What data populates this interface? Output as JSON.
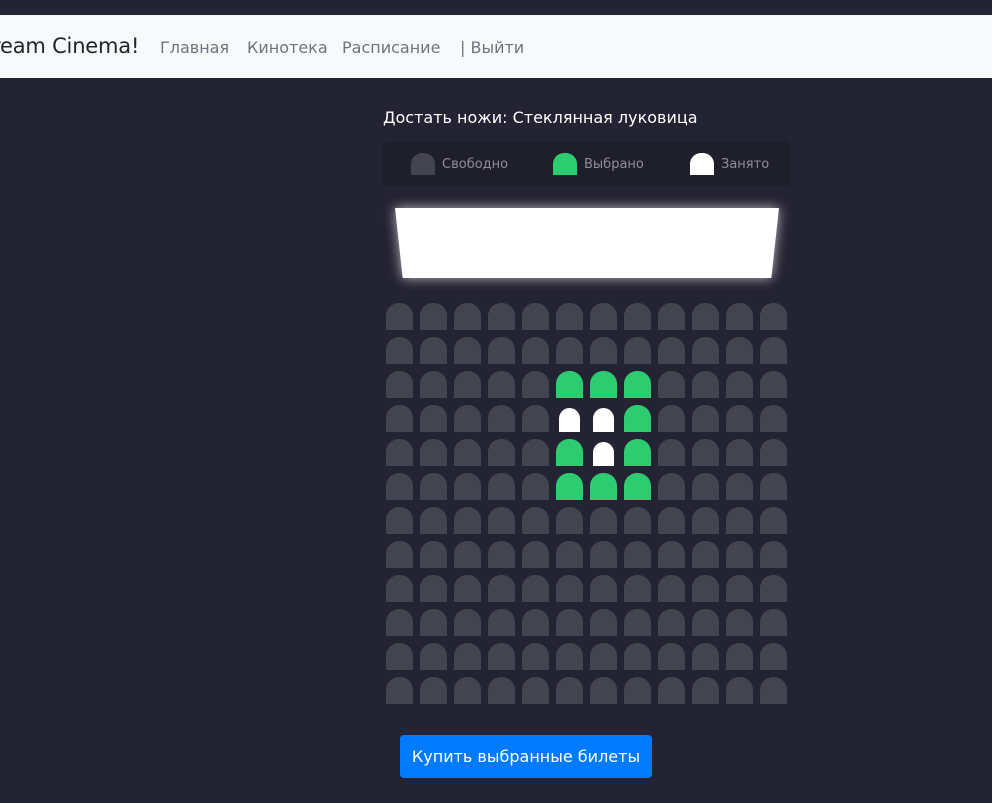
{
  "navbar": {
    "brand": "ream Cinema!",
    "links": [
      "Главная",
      "Кинотека",
      "Расписание",
      "| Выйти"
    ]
  },
  "movie": {
    "title": "Достать ножи: Стеклянная луковица"
  },
  "legend": {
    "items": [
      {
        "label": "Свободно",
        "state": "free"
      },
      {
        "label": "Выбрано",
        "state": "selected"
      },
      {
        "label": "Занято",
        "state": "occupied"
      }
    ]
  },
  "colors": {
    "background": "#242333",
    "seat_free": "#444451",
    "seat_selected": "#2ecc71",
    "seat_occupied": "#ffffff",
    "button": "#007bff"
  },
  "seats": {
    "rows": [
      [
        "free",
        "free",
        "free",
        "free",
        "free",
        "free",
        "free",
        "free",
        "free",
        "free",
        "free",
        "free"
      ],
      [
        "free",
        "free",
        "free",
        "free",
        "free",
        "free",
        "free",
        "free",
        "free",
        "free",
        "free",
        "free"
      ],
      [
        "free",
        "free",
        "free",
        "free",
        "free",
        "selected",
        "selected",
        "selected",
        "free",
        "free",
        "free",
        "free"
      ],
      [
        "free",
        "free",
        "free",
        "free",
        "free",
        "occupied",
        "occupied",
        "selected",
        "free",
        "free",
        "free",
        "free"
      ],
      [
        "free",
        "free",
        "free",
        "free",
        "free",
        "selected",
        "occupied",
        "selected",
        "free",
        "free",
        "free",
        "free"
      ],
      [
        "free",
        "free",
        "free",
        "free",
        "free",
        "selected",
        "selected",
        "selected",
        "free",
        "free",
        "free",
        "free"
      ],
      [
        "free",
        "free",
        "free",
        "free",
        "free",
        "free",
        "free",
        "free",
        "free",
        "free",
        "free",
        "free"
      ],
      [
        "free",
        "free",
        "free",
        "free",
        "free",
        "free",
        "free",
        "free",
        "free",
        "free",
        "free",
        "free"
      ],
      [
        "free",
        "free",
        "free",
        "free",
        "free",
        "free",
        "free",
        "free",
        "free",
        "free",
        "free",
        "free"
      ],
      [
        "free",
        "free",
        "free",
        "free",
        "free",
        "free",
        "free",
        "free",
        "free",
        "free",
        "free",
        "free"
      ],
      [
        "free",
        "free",
        "free",
        "free",
        "free",
        "free",
        "free",
        "free",
        "free",
        "free",
        "free",
        "free"
      ],
      [
        "free",
        "free",
        "free",
        "free",
        "free",
        "free",
        "free",
        "free",
        "free",
        "free",
        "free",
        "free"
      ]
    ]
  },
  "buy_button": {
    "label": "Купить выбранные билеты"
  }
}
